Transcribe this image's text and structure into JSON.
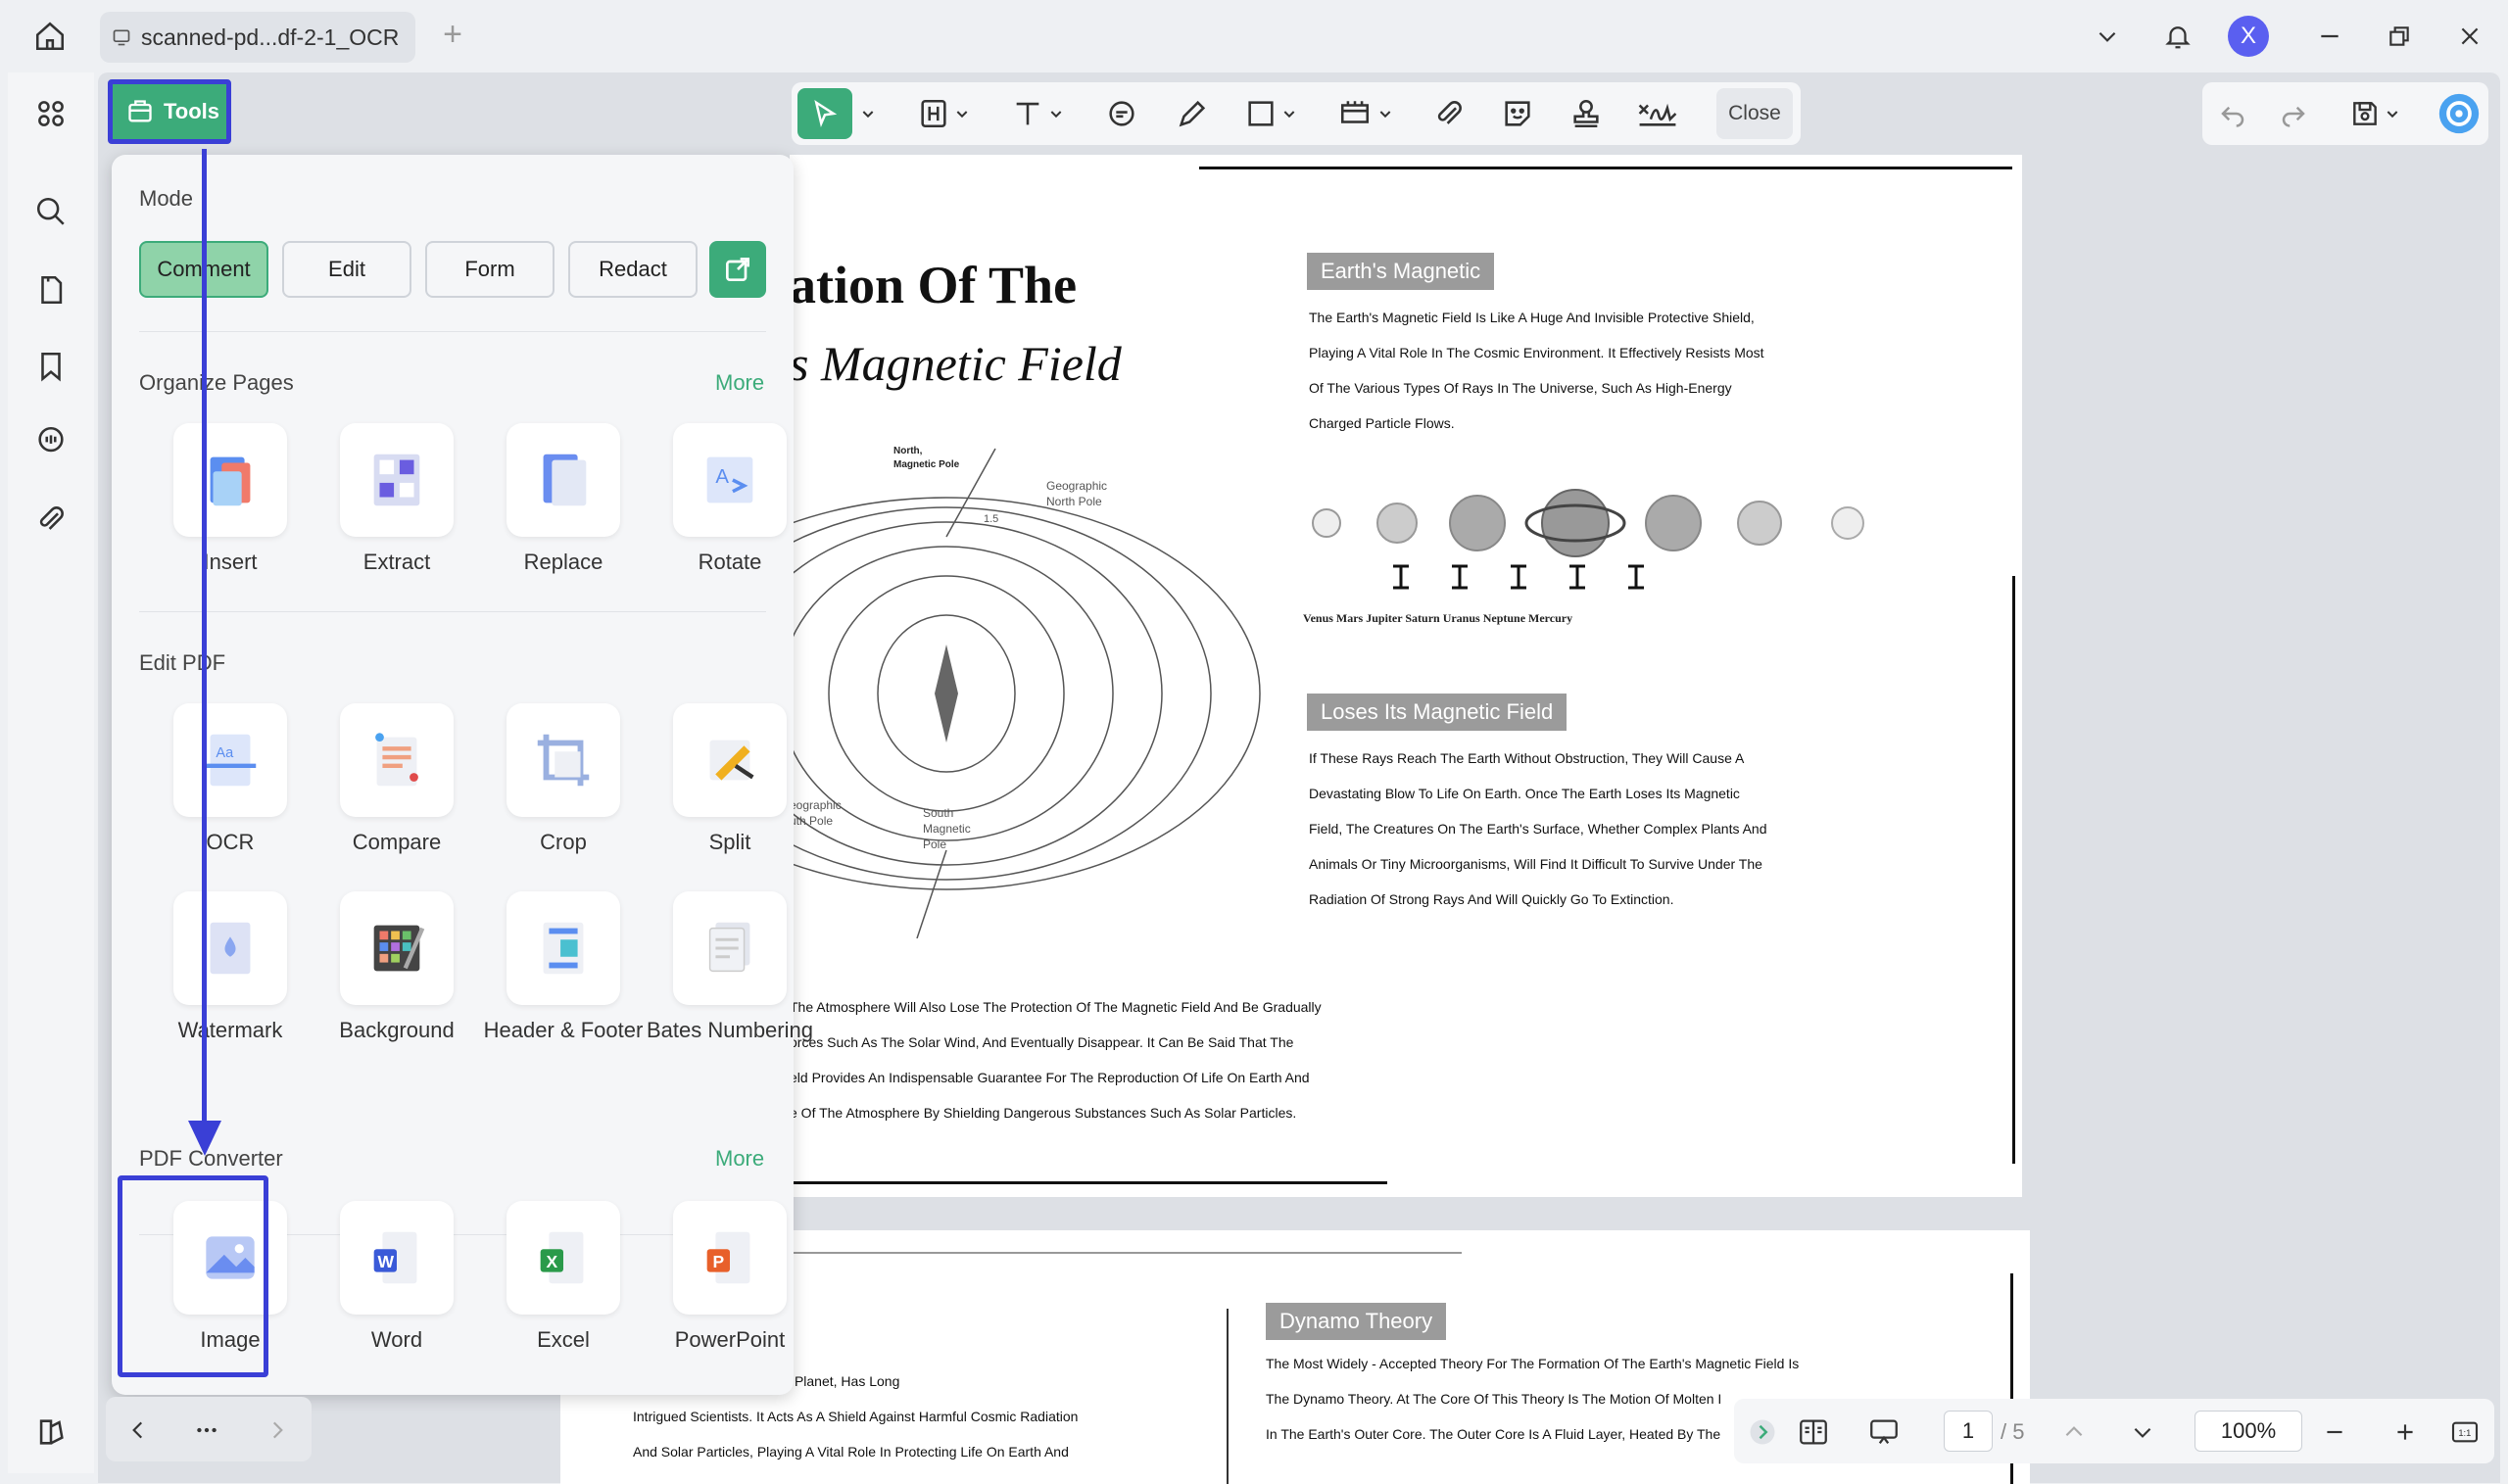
{
  "tab": {
    "title": "scanned-pd...df-2-1_OCR"
  },
  "avatar": {
    "initial": "X",
    "color": "#5a5ff0"
  },
  "tools_button": {
    "label": "Tools"
  },
  "toolbar": {
    "close_label": "Close"
  },
  "panel": {
    "mode_title": "Mode",
    "modes": [
      "Comment",
      "Edit",
      "Form",
      "Redact"
    ],
    "active_mode": "Comment",
    "organize": {
      "title": "Organize Pages",
      "more": "More",
      "items": [
        "Insert",
        "Extract",
        "Replace",
        "Rotate"
      ]
    },
    "edit_pdf": {
      "title": "Edit PDF",
      "items": [
        "OCR",
        "Compare",
        "Crop",
        "Split",
        "Watermark",
        "Background",
        "Header & Footer",
        "Bates Numbering"
      ]
    },
    "converter": {
      "title": "PDF Converter",
      "more": "More",
      "items": [
        "Image",
        "Word",
        "Excel",
        "PowerPoint"
      ]
    }
  },
  "document": {
    "title_line1": "ation Of The",
    "title_line2": "s Magnetic Field",
    "tag1": "Earth's Magnetic",
    "para1": [
      "The Earth's Magnetic Field Is Like A Huge And Invisible Protective Shield,",
      "Playing A Vital Role In The Cosmic Environment. It Effectively Resists Most",
      "Of The Various Types Of Rays In The Universe, Such As High-Energy",
      "Charged Particle Flows."
    ],
    "planets_caption": "Venus Mars Jupiter Saturn Uranus Neptune Mercury",
    "tag2": "Loses Its Magnetic Field",
    "para2": [
      "If These Rays Reach The Earth Without Obstruction, They Will Cause A",
      "Devastating Blow To Life On Earth. Once The Earth Loses Its Magnetic",
      "Field, The Creatures On The Earth's Surface, Whether Complex Plants And",
      "Animals Or Tiny Microorganisms, Will Find It Difficult To Survive Under The",
      "Radiation Of Strong Rays And Will Quickly Go To Extinction."
    ],
    "para3": [
      "The Atmosphere Will Also Lose The Protection Of The Magnetic Field And Be Gradually",
      "orces Such As The Solar Wind, And Eventually Disappear. It Can Be Said That The",
      "eld Provides An Indispensable Guarantee For The Reproduction Of Life On Earth And",
      "e Of The Atmosphere By Shielding Dangerous Substances Such As Solar Particles."
    ],
    "diagram_labels": {
      "north": "North,",
      "north2": "Magnetic Pole",
      "geo_north": "Geographic",
      "geo_north2": "North Pole",
      "angle": "1.5",
      "south": "South",
      "south2": "Magnetic",
      "south3": "Pole",
      "geo_south": "eographic",
      "geo_south2": "uth Pole"
    },
    "tag3": "Dynamo Theory",
    "para4": [
      "The Most Widely - Accepted Theory For The Formation Of The Earth's Magnetic Field Is",
      "The Dynamo Theory. At The Core Of This Theory Is The Motion Of Molten I",
      "In The Earth's Outer Core. The Outer Core Is A Fluid Layer, Heated By The"
    ],
    "para5": [
      ", A Crucial Feature Of Our Planet, Has Long",
      "Intrigued Scientists. It Acts As A Shield Against Harmful Cosmic Radiation",
      "And Solar Particles, Playing A Vital Role In Protecting Life On Earth And"
    ]
  },
  "pager": {
    "current": "1",
    "total": "/ 5",
    "zoom": "100%"
  }
}
